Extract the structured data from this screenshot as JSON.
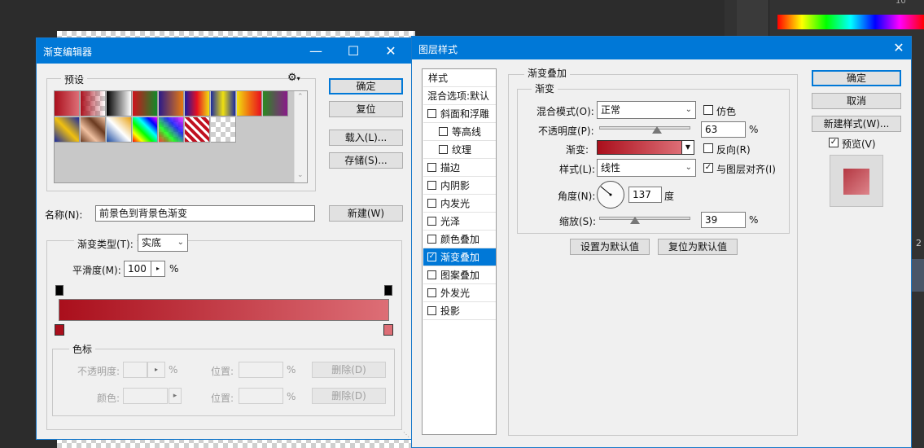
{
  "gradient_editor": {
    "title": "渐变编辑器",
    "presets_label": "预设",
    "buttons": {
      "ok": "确定",
      "reset": "复位",
      "load": "载入(L)...",
      "save": "存储(S)...",
      "new": "新建(W)"
    },
    "name_label": "名称(N):",
    "name_value": "前景色到背景色渐变",
    "gradient_type_label": "渐变类型(T):",
    "gradient_type_value": "实底",
    "smoothness_label": "平滑度(M):",
    "smoothness_value": "100",
    "smoothness_unit": "%",
    "stops_group": "色标",
    "opacity_label": "不透明度:",
    "percent": "%",
    "location_label": "位置:",
    "color_label": "颜色:",
    "delete_label": "删除(D)",
    "gradient_colors": {
      "start": "#aa0f1c",
      "end": "#dd6e76"
    }
  },
  "layer_style": {
    "title": "图层样式",
    "styles_header": "样式",
    "blend_options": "混合选项:默认",
    "items": [
      {
        "label": "斜面和浮雕",
        "checked": false,
        "indent": false
      },
      {
        "label": "等高线",
        "checked": false,
        "indent": true
      },
      {
        "label": "纹理",
        "checked": false,
        "indent": true
      },
      {
        "label": "描边",
        "checked": false,
        "indent": false
      },
      {
        "label": "内阴影",
        "checked": false,
        "indent": false
      },
      {
        "label": "内发光",
        "checked": false,
        "indent": false
      },
      {
        "label": "光泽",
        "checked": false,
        "indent": false
      },
      {
        "label": "颜色叠加",
        "checked": false,
        "indent": false
      },
      {
        "label": "渐变叠加",
        "checked": true,
        "indent": false,
        "selected": true
      },
      {
        "label": "图案叠加",
        "checked": false,
        "indent": false
      },
      {
        "label": "外发光",
        "checked": false,
        "indent": false
      },
      {
        "label": "投影",
        "checked": false,
        "indent": false
      }
    ],
    "section_title": "渐变叠加",
    "group_title": "渐变",
    "blend_mode_label": "混合模式(O):",
    "blend_mode_value": "正常",
    "dither_label": "仿色",
    "opacity_label": "不透明度(P):",
    "opacity_value": "63",
    "percent": "%",
    "gradient_label": "渐变:",
    "reverse_label": "反向(R)",
    "style_label": "样式(L):",
    "style_value": "线性",
    "align_label": "与图层对齐(I)",
    "angle_label": "角度(N):",
    "angle_value": "137",
    "angle_unit": "度",
    "scale_label": "缩放(S):",
    "scale_value": "39",
    "make_default": "设置为默认值",
    "reset_default": "复位为默认值",
    "buttons": {
      "ok": "确定",
      "cancel": "取消",
      "new_style": "新建样式(W)...",
      "preview": "预览(V)"
    },
    "opacity_level": 0.63,
    "scale_level": 0.39
  },
  "background": {
    "ruler_number": "10",
    "side_letter": "2"
  }
}
